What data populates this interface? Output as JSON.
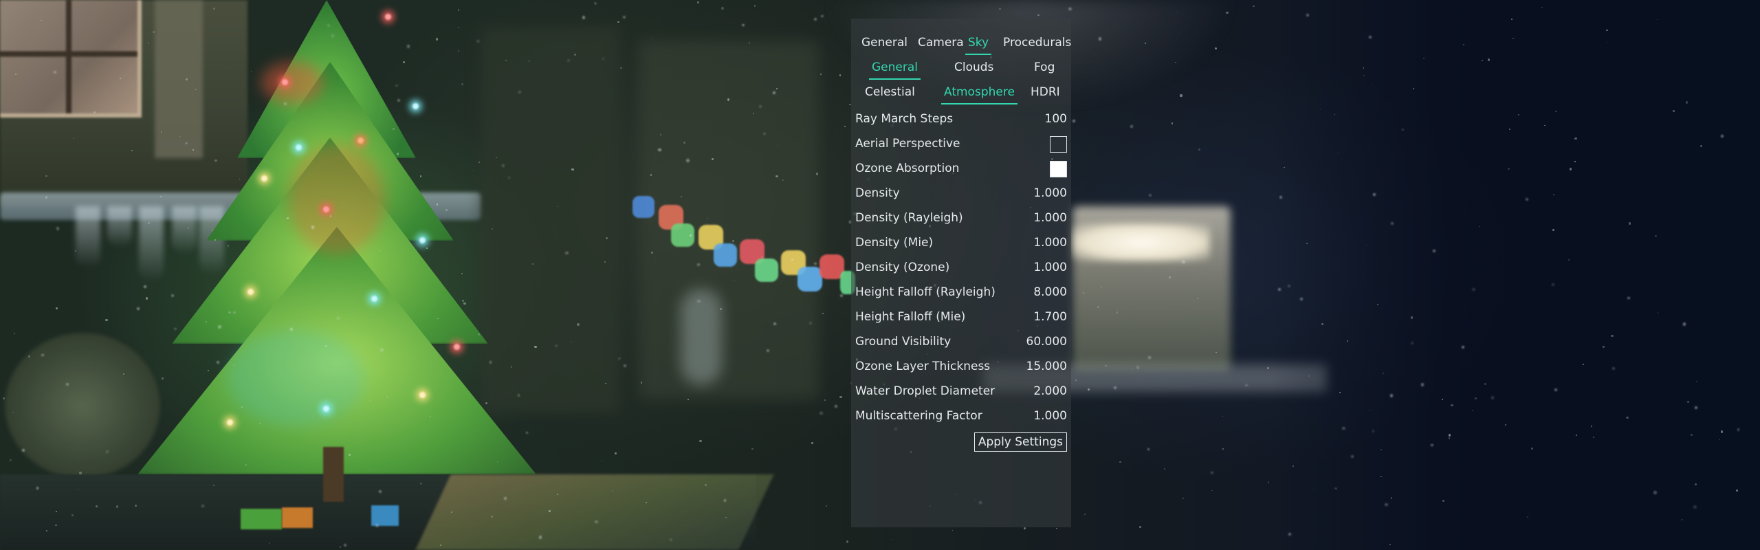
{
  "tabs_main": [
    {
      "label": "General",
      "active": false
    },
    {
      "label": "Camera",
      "active": false
    },
    {
      "label": "Sky",
      "active": true
    },
    {
      "label": "Procedurals",
      "active": false
    }
  ],
  "tabs_sub1": [
    {
      "label": "General",
      "active": true
    },
    {
      "label": "Clouds",
      "active": false
    },
    {
      "label": "Fog",
      "active": false
    }
  ],
  "tabs_sub2": [
    {
      "label": "Celestial",
      "active": false
    },
    {
      "label": "Atmosphere",
      "active": true
    },
    {
      "label": "HDRI",
      "active": false
    }
  ],
  "settings": {
    "ray_march_steps": {
      "label": "Ray March Steps",
      "value": "100"
    },
    "aerial_perspective": {
      "label": "Aerial Perspective",
      "checked": false
    },
    "ozone_absorption": {
      "label": "Ozone Absorption",
      "checked": true
    },
    "density": {
      "label": "Density",
      "value": "1.000"
    },
    "density_rayleigh": {
      "label": "Density (Rayleigh)",
      "value": "1.000"
    },
    "density_mie": {
      "label": "Density (Mie)",
      "value": "1.000"
    },
    "density_ozone": {
      "label": "Density (Ozone)",
      "value": "1.000"
    },
    "height_falloff_rayleigh": {
      "label": "Height Falloff (Rayleigh)",
      "value": "8.000"
    },
    "height_falloff_mie": {
      "label": "Height Falloff (Mie)",
      "value": "1.700"
    },
    "ground_visibility": {
      "label": "Ground Visibility",
      "value": "60.000"
    },
    "ozone_layer_thickness": {
      "label": "Ozone Layer Thickness",
      "value": "15.000"
    },
    "water_droplet_diameter": {
      "label": "Water Droplet Diameter",
      "value": "2.000"
    },
    "multiscattering_factor": {
      "label": "Multiscattering Factor",
      "value": "1.000"
    }
  },
  "apply_button": {
    "label": "Apply Settings"
  },
  "colors": {
    "accent": "#32d7b0",
    "panel_bg": "rgba(56,62,66,0.55)",
    "text": "#e6eaed"
  }
}
